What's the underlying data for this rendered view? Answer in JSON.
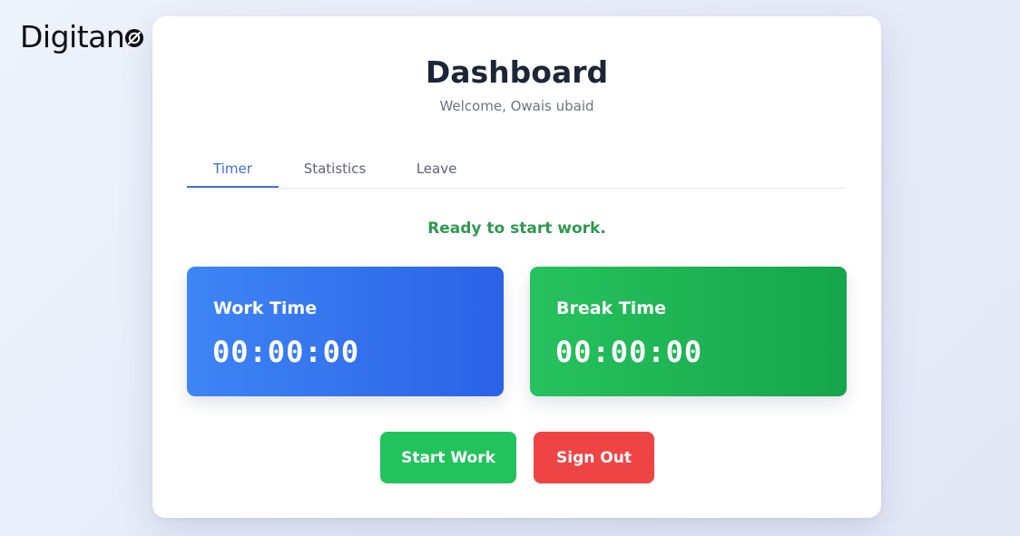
{
  "brand": {
    "name": "Digitan",
    "mark_icon": "power-o-icon"
  },
  "dashboard": {
    "title": "Dashboard",
    "welcome": "Welcome, Owais ubaid"
  },
  "tabs": [
    {
      "label": "Timer",
      "active": true
    },
    {
      "label": "Statistics",
      "active": false
    },
    {
      "label": "Leave",
      "active": false
    }
  ],
  "status": "Ready to start work.",
  "timers": {
    "work": {
      "label": "Work Time",
      "value": "00:00:00"
    },
    "break": {
      "label": "Break Time",
      "value": "00:00:00"
    }
  },
  "actions": {
    "start_label": "Start Work",
    "signout_label": "Sign Out"
  },
  "colors": {
    "accent_blue": "#3f74dc",
    "success_green": "#22c35d",
    "danger_red": "#ef4444"
  }
}
